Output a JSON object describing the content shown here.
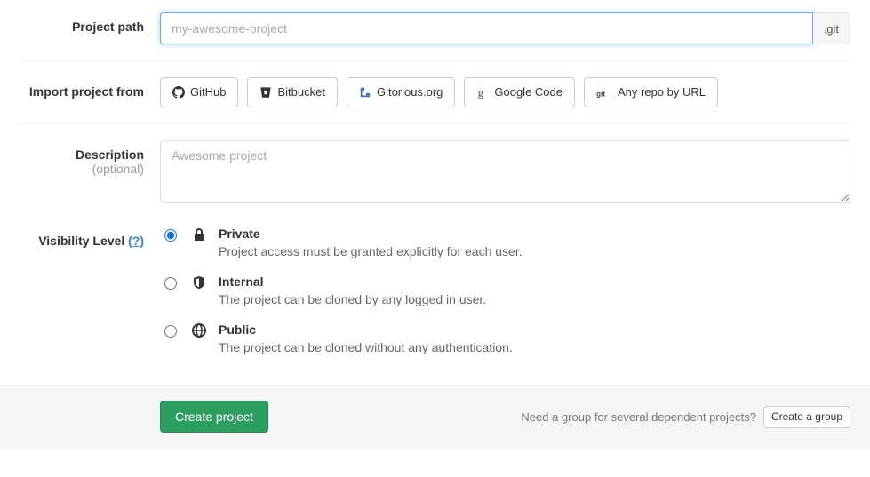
{
  "labels": {
    "project_path": "Project path",
    "import_from": "Import project from",
    "description": "Description",
    "description_optional": "(optional)",
    "visibility": "Visibility Level",
    "visibility_help": "(?)"
  },
  "project_path": {
    "placeholder": "my-awesome-project",
    "suffix": ".git"
  },
  "import_buttons": [
    {
      "name": "github",
      "label": "GitHub"
    },
    {
      "name": "bitbucket",
      "label": "Bitbucket"
    },
    {
      "name": "gitorious",
      "label": "Gitorious.org"
    },
    {
      "name": "google-code",
      "label": "Google Code"
    },
    {
      "name": "any-repo",
      "label": "Any repo by URL"
    }
  ],
  "description_placeholder": "Awesome project",
  "visibility_options": [
    {
      "value": "private",
      "label": "Private",
      "desc": "Project access must be granted explicitly for each user.",
      "selected": true
    },
    {
      "value": "internal",
      "label": "Internal",
      "desc": "The project can be cloned by any logged in user.",
      "selected": false
    },
    {
      "value": "public",
      "label": "Public",
      "desc": "The project can be cloned without any authentication.",
      "selected": false
    }
  ],
  "footer": {
    "submit": "Create project",
    "group_hint": "Need a group for several dependent projects?",
    "create_group": "Create a group"
  }
}
